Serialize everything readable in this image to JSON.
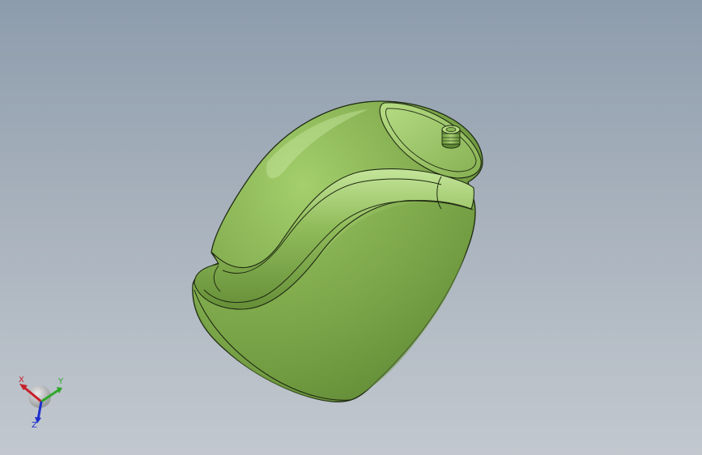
{
  "viewport": {
    "background_top": "#8d9cac",
    "background_bottom": "#c2c8cf"
  },
  "model": {
    "body_color": "#7fa84c",
    "edge_color": "#1f2a12"
  },
  "triad": {
    "x_label": "X",
    "y_label": "Y",
    "z_label": "Z",
    "x_color": "#c8202a",
    "y_color": "#2fa82a",
    "z_color": "#1c2fd0"
  }
}
